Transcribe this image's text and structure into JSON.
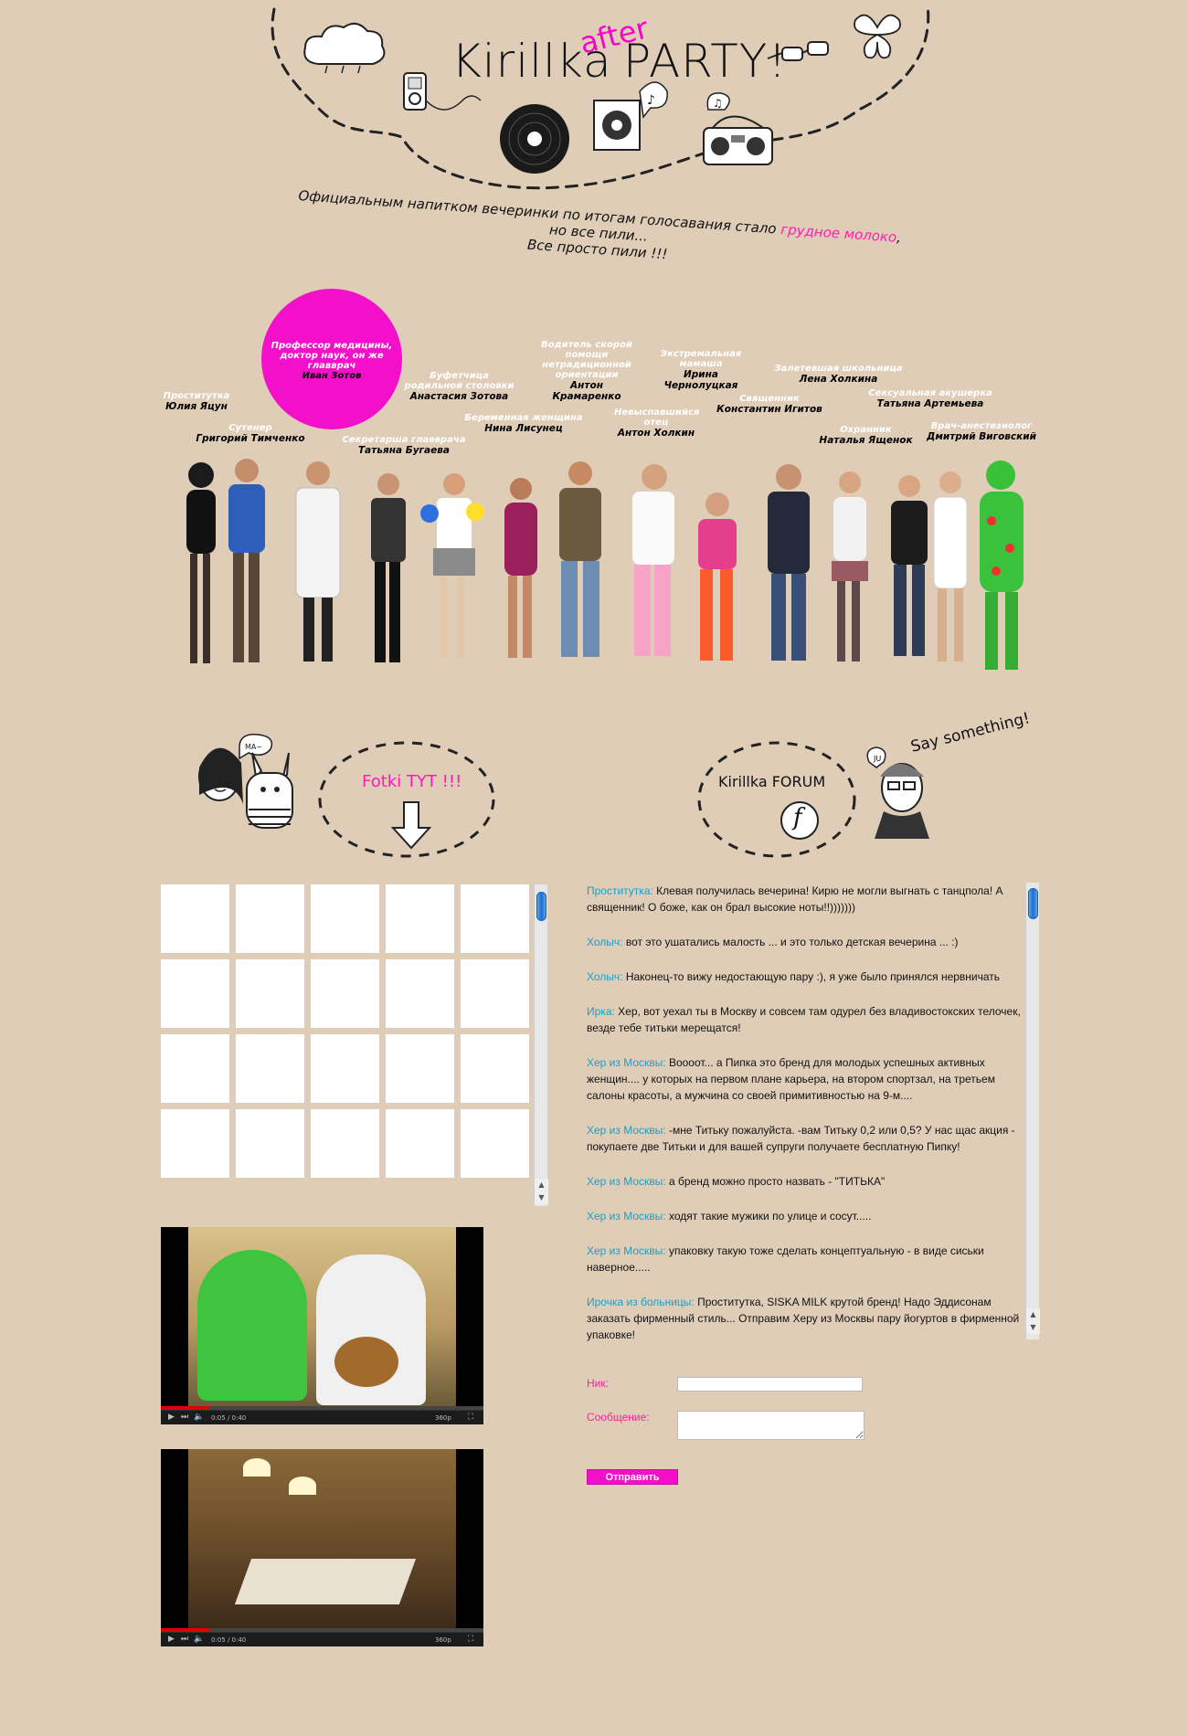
{
  "header": {
    "title_part1": "Kirillka",
    "title_after": "after",
    "title_part2": "PARTY!",
    "tagline_before": "Официальным напитком вечеринки по итогам голосавания стало",
    "tagline_highlight": "грудное молоко",
    "tagline_after": ", но все пили...",
    "tagline_line2": "Все просто пили !!!"
  },
  "cast": {
    "featured": {
      "role": "Профессор медицины, доктор наук, он же главврач",
      "name": "Иван Зотов"
    },
    "people": [
      {
        "role": "Проститутка",
        "name": "Юлия Яцун"
      },
      {
        "role": "Сутенер",
        "name": "Григорий Тимченко"
      },
      {
        "role": "Секретарша главврача",
        "name": "Татьяна Бугаева"
      },
      {
        "role": "Буфетчица родильной столовки",
        "name": "Анастасия Зотова"
      },
      {
        "role": "Беременная женщина",
        "name": "Нина Лисунец"
      },
      {
        "role": "Водитель скорой помощи нетрадиционной ориентации",
        "name": "Антон Крамаренко"
      },
      {
        "role": "Невыспавшийся отец",
        "name": "Антон Холкин"
      },
      {
        "role": "Экстремальная мамаша",
        "name": "Ирина Чернолуцкая"
      },
      {
        "role": "Священник",
        "name": "Константин Игитов"
      },
      {
        "role": "Залетевшая школьница",
        "name": "Лена Холкина"
      },
      {
        "role": "Охранник",
        "name": "Наталья Ященок"
      },
      {
        "role": "Сексуальная акушерка",
        "name": "Татьяна Артемьева"
      },
      {
        "role": "Врач-анестезиолог",
        "name": "Дмитрий Виговский"
      }
    ]
  },
  "doodles": {
    "speech_ma": "MA~",
    "fotki_label": "Fotki TYT !!!",
    "forum_label": "Kirillka FORUM",
    "forum_letter": "f",
    "say_something": "Say something!",
    "speech_ju": "JU"
  },
  "videos": [
    {
      "time": "0:05 / 0:40",
      "quality": "360p",
      "progress": 0.15
    },
    {
      "time": "0:05 / 0:40",
      "quality": "360p",
      "progress": 0.15
    }
  ],
  "chat": {
    "messages": [
      {
        "nick": "Проститутка:",
        "text": " Клевая получилась вечерина! Кирю не могли выгнать с танцпола! А священник! О боже, как он брал высокие ноты!!)))))))"
      },
      {
        "nick": "Холыч:",
        "text": " вот это ушатались малость ... и это только детская вечерина ... :)"
      },
      {
        "nick": "Холыч:",
        "text": " Наконец-то вижу недостающую пару :), я уже было принялся нервничать"
      },
      {
        "nick": "Ирка:",
        "text": " Хер, вот уехал ты в Москву и совсем там одурел без владивостокских телочек, везде тебе титьки мерещатся!"
      },
      {
        "nick": "Хер из Москвы:",
        "text": " Воооот... а Пипка это бренд для молодых успешных активных женщин.... у которых на первом плане карьера, на втором спортзал, на третьем салоны красоты, а мужчина со своей примитивностью на 9-м...."
      },
      {
        "nick": "Хер из Москвы:",
        "text": " -мне Титьку пожалуйста. -вам Титьку 0,2 или 0,5? У нас щас акция - покупаете две Титьки и для вашей супруги получаете бесплатную Пипку!"
      },
      {
        "nick": "Хер из Москвы:",
        "text": " а бренд можно просто назвать - \"ТИТЬКА\""
      },
      {
        "nick": "Хер из Москвы:",
        "text": " ходят такие мужики по улице и сосут....."
      },
      {
        "nick": "Хер из Москвы:",
        "text": " упаковку такую тоже сделать концептуальную - в виде сиськи наверное....."
      },
      {
        "nick": "Ирочка из больницы:",
        "text": " Проститутка, SISKA MILK крутой бренд! Надо Эддисонам заказать фирменный стиль... Отправим Херу из Москвы пару йогуртов в фирменной упаковке!"
      }
    ]
  },
  "form": {
    "nick_label": "Ник:",
    "message_label": "Сообщение:",
    "nick_value": "",
    "message_value": "",
    "submit_label": "Отправить"
  },
  "colors": {
    "background": "#dfcdb8",
    "accent_pink": "#f40fca",
    "nick_blue": "#1aa0c8"
  }
}
